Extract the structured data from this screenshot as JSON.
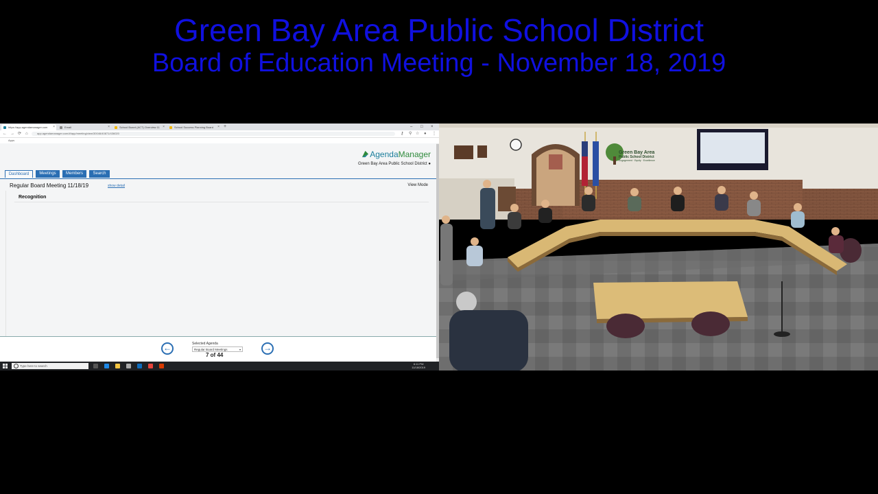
{
  "broadcast": {
    "title_line1": "Green Bay Area Public School District",
    "title_line2": "Board of Education Meeting - November 18, 2019",
    "title_color": "#1010e0"
  },
  "browser": {
    "tabs": [
      {
        "label": "https://app.agendamanager.com",
        "active": true
      },
      {
        "label": "Email",
        "active": false
      },
      {
        "label": "School Board (ACT) Overview 11",
        "active": false
      },
      {
        "label": "School Success Planning Board",
        "active": false
      }
    ],
    "new_tab_symbol": "+",
    "url": "app.agendamanager.com/#/app/meeting/view/30046/40871/436020",
    "bookmarks_label": "Apps"
  },
  "app": {
    "logo_agenda": "Agenda",
    "logo_manager": "Manager",
    "org_name": "Green Bay Area Public School District",
    "nav": [
      {
        "label": "Dashboard",
        "active": true
      },
      {
        "label": "Meetings",
        "active": false
      },
      {
        "label": "Members",
        "active": false
      },
      {
        "label": "Search",
        "active": false
      }
    ],
    "meeting_title": "Regular Board Meeting 11/18/19",
    "show_detail": "show detail",
    "view_mode": "View Mode",
    "item_title": "Recognition",
    "footer": {
      "selected_agenda_label": "Selected Agenda",
      "selected_agenda_value": "Regular Board Meetings",
      "counter": "7 of 44",
      "prev_symbol": "←",
      "next_symbol": "→"
    },
    "brand_color": "#2a6eb3"
  },
  "taskbar": {
    "search_placeholder": "Type here to search",
    "time": "6:11 PM",
    "date": "11/18/2019"
  },
  "camera": {
    "room_logo_line1": "Green Bay Area",
    "room_logo_line2": "Public School District",
    "room_logo_line3": "Engagement · Equity · Excellence"
  }
}
